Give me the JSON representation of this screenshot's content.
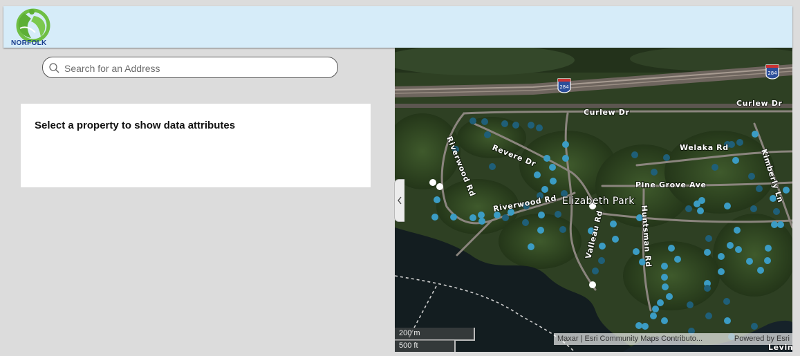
{
  "header": {
    "logo_text": "NORFOLK"
  },
  "search": {
    "placeholder": "Search for an Address",
    "value": ""
  },
  "info_panel": {
    "title": "Select a property to show data attributes"
  },
  "map": {
    "roads": [
      {
        "name": "Curlew Dr"
      },
      {
        "name": "Curlew Dr"
      },
      {
        "name": "Revere Dr"
      },
      {
        "name": "Riverwood Rd"
      },
      {
        "name": "Riverwood Rd"
      },
      {
        "name": "Welaka Rd"
      },
      {
        "name": "Kimberly Ln"
      },
      {
        "name": "Pine Grove Ave"
      },
      {
        "name": "Huntsman Rd"
      },
      {
        "name": "Valleau Rd"
      },
      {
        "name": "Levine"
      }
    ],
    "park_label": "Elizabeth Park",
    "highway_shield": "284",
    "scale_metric": "200 m",
    "scale_imperial": "500 ft",
    "attribution": "Maxar | Esri Community Maps Contributo...",
    "powered_by": "Powered by Esri",
    "colors": {
      "parcel_light": "#3b9cc4",
      "parcel_dark": "#1f5f78",
      "parcel_selected": "#ffffff",
      "highway": "#7a6e66"
    }
  }
}
